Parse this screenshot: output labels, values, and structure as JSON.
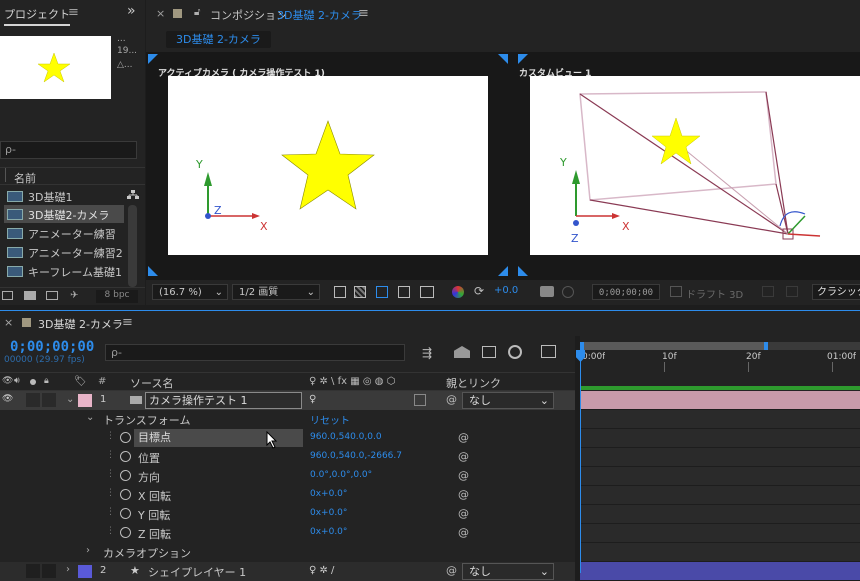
{
  "project": {
    "tab": "プロジェクト",
    "menu": "≡",
    "expand": "»",
    "thumb_info": [
      "...",
      "19...",
      "△..."
    ],
    "search_placeholder": "ρ-",
    "name_header": "名前",
    "items": [
      {
        "label": "3D基礎1",
        "selected": false
      },
      {
        "label": "3D基礎2-カメラ",
        "selected": true
      },
      {
        "label": "アニメーター練習",
        "selected": false
      },
      {
        "label": "アニメーター練習2",
        "selected": false
      },
      {
        "label": "キーフレーム基礎1",
        "selected": false
      }
    ],
    "bpc": "8 bpc"
  },
  "composition": {
    "close": "×",
    "title_prefix": "コンポジション",
    "title_name": "3D基礎 2-カメラ",
    "menu": "≡",
    "tab": "3D基礎 2-カメラ",
    "view1_label": "アクティブカメラ ( カメラ操作テスト 1)",
    "view2_label": "カスタムビュー 1",
    "axis_y": "Y",
    "axis_z": "Z",
    "axis_x": "X",
    "star_color": "#ffff00",
    "toolbar": {
      "zoom": "(16.7 %)",
      "resolution": "1/2 画質",
      "exposure": "+0.0",
      "timecode": "0;00;00;00",
      "draft": "ドラフト 3D",
      "classic": "クラシック"
    }
  },
  "timeline": {
    "close": "×",
    "tab": "3D基礎 2-カメラ",
    "menu": "≡",
    "timecode": "0;00;00;00",
    "frames": "00000 (29.97 fps)",
    "search_placeholder": "ρ-",
    "columns": {
      "num": "#",
      "source": "ソース名",
      "parent": "親とリンク"
    },
    "ruler": [
      "0:00f",
      "10f",
      "20f",
      "01:00f"
    ],
    "layer1": {
      "num": "1",
      "name": "カメラ操作テスト 1",
      "parent": "なし",
      "color": "#e8b4c8"
    },
    "transform": {
      "label": "トランスフォーム",
      "reset": "リセット"
    },
    "props": [
      {
        "label": "目標点",
        "value": "960.0,540.0,0.0"
      },
      {
        "label": "位置",
        "value": "960.0,540.0,-2666.7"
      },
      {
        "label": "方向",
        "value": "0.0°,0.0°,0.0°"
      },
      {
        "label": "X 回転",
        "value": "0x+0.0°"
      },
      {
        "label": "Y 回転",
        "value": "0x+0.0°"
      },
      {
        "label": "Z 回転",
        "value": "0x+0.0°"
      }
    ],
    "camera_options": "カメラオプション",
    "layer2": {
      "num": "2",
      "name": "シェイプレイヤー 1",
      "parent": "なし",
      "color": "#5a5ad8"
    }
  }
}
